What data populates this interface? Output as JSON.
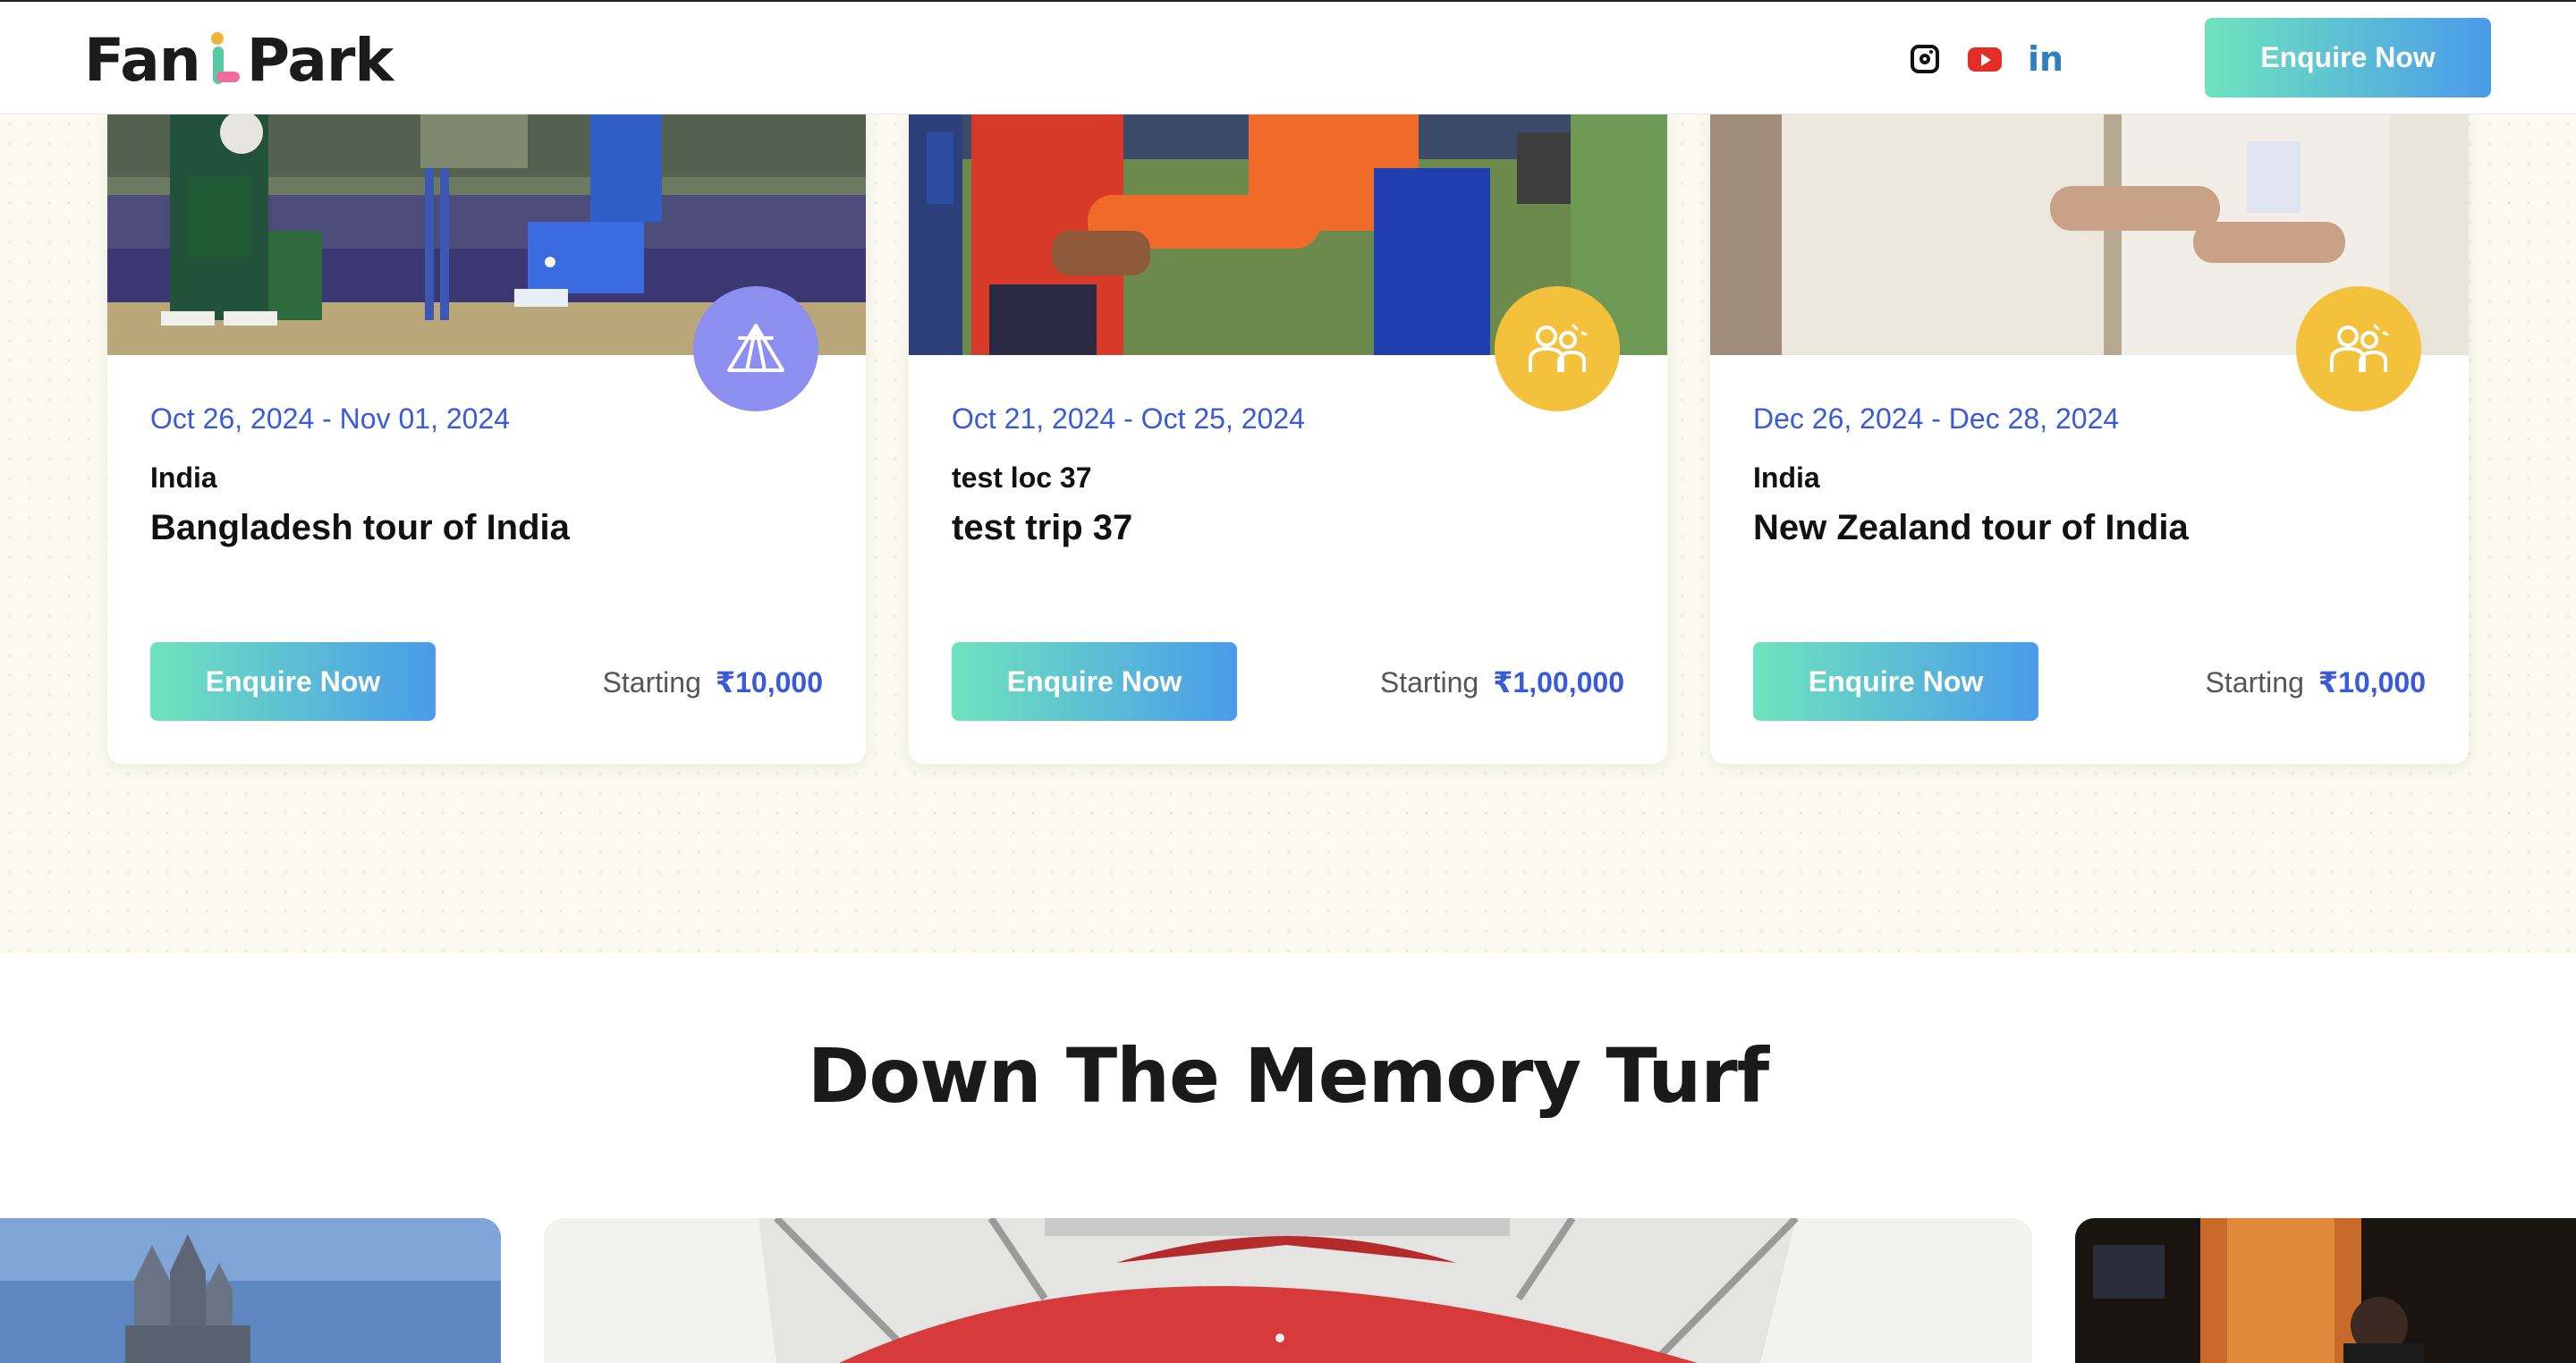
{
  "header": {
    "logo_text_left": "Fan",
    "logo_text_right": "Park",
    "social": [
      "instagram-icon",
      "youtube-icon",
      "linkedin-icon"
    ],
    "linkedin_glyph": "in",
    "enquire_label": "Enquire Now"
  },
  "trips": [
    {
      "date": "Oct 26, 2024 - Nov 01, 2024",
      "location": "India",
      "title": "Bangladesh tour of India",
      "enquire_label": "Enquire Now",
      "starting_label": "Starting",
      "price": "₹10,000",
      "badge_icon": "tent-icon",
      "badge_color": "#8c8ff0"
    },
    {
      "date": "Oct 21, 2024 - Oct 25, 2024",
      "location": "test loc 37",
      "title": "test trip 37",
      "enquire_label": "Enquire Now",
      "starting_label": "Starting",
      "price": "₹1,00,000",
      "badge_icon": "fans-icon",
      "badge_color": "#f3c13c"
    },
    {
      "date": "Dec 26, 2024 - Dec 28, 2024",
      "location": "India",
      "title": "New Zealand tour of India",
      "enquire_label": "Enquire Now",
      "starting_label": "Starting",
      "price": "₹10,000",
      "badge_icon": "fans-icon",
      "badge_color": "#f3c13c"
    }
  ],
  "memory": {
    "title": "Down The Memory Turf"
  },
  "colors": {
    "accent_blue": "#3a5bd9",
    "gradient_start": "#6fe3bd",
    "gradient_end": "#4a9bea",
    "section_bg": "#fbfaf0"
  }
}
